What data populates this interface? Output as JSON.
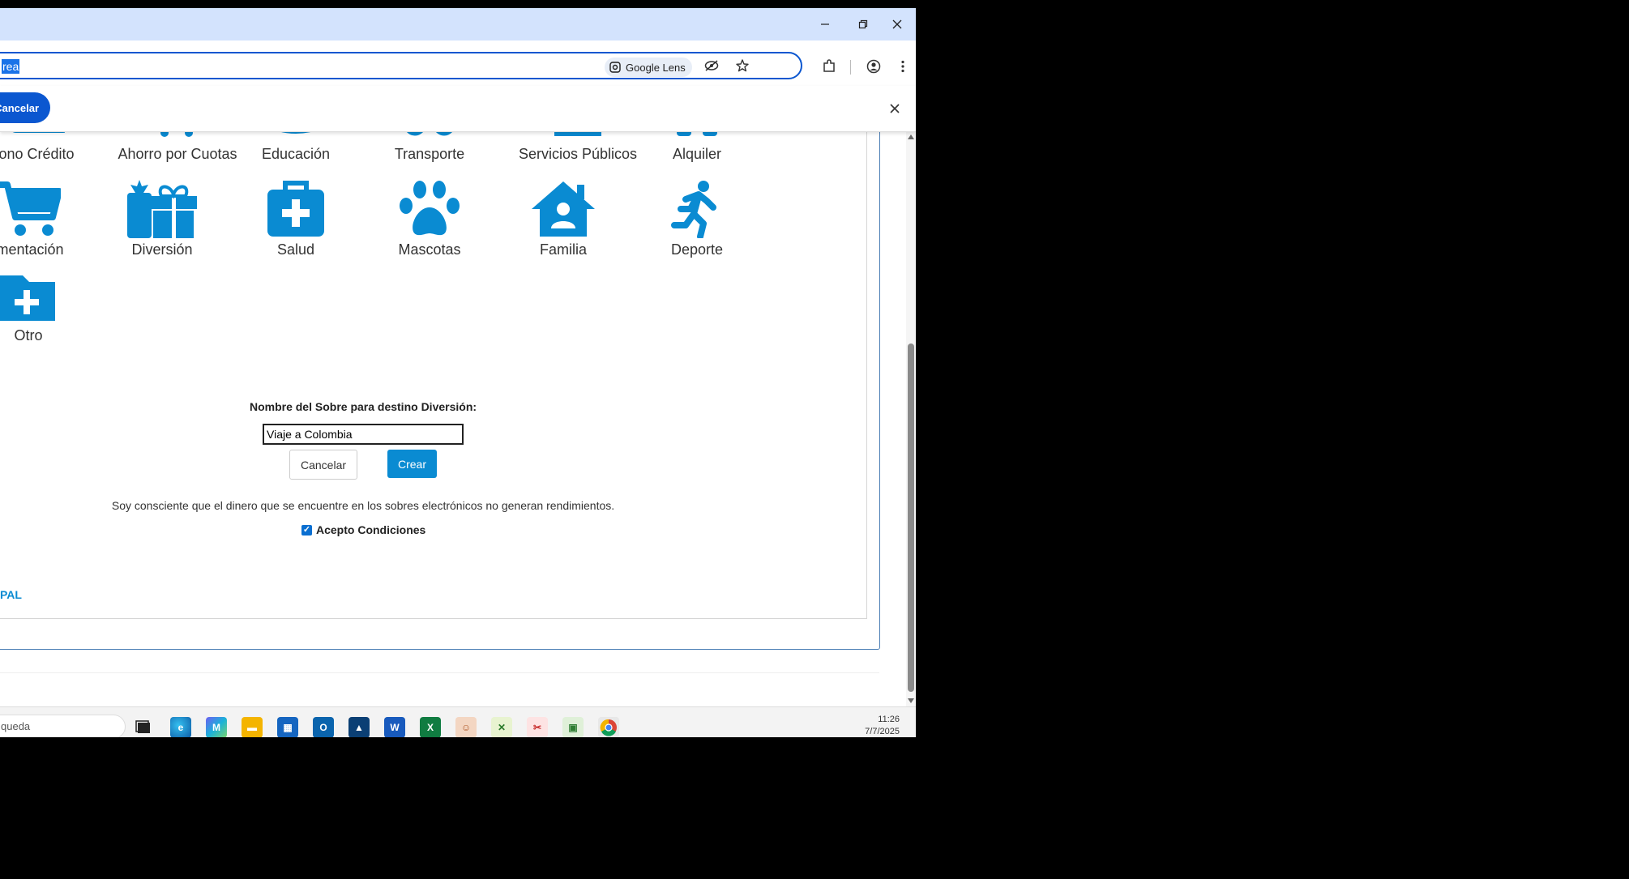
{
  "browser": {
    "address_text": "rea",
    "lens_label": "Google Lens",
    "find_bar": {
      "cancel_label": "Cancelar"
    }
  },
  "categories_row1": [
    {
      "label": "ono Crédito",
      "icon": "credit-icon"
    },
    {
      "label": "Ahorro por Cuotas",
      "icon": "cart-icon"
    },
    {
      "label": "Educación",
      "icon": "education-icon"
    },
    {
      "label": "Transporte",
      "icon": "transport-icon"
    },
    {
      "label": "Servicios Públicos",
      "icon": "building-icon"
    },
    {
      "label": "Alquiler",
      "icon": "rent-icon"
    }
  ],
  "categories_row2": [
    {
      "label": "imentación",
      "icon": "shopping-cart-icon"
    },
    {
      "label": "Diversión",
      "icon": "gift-icon"
    },
    {
      "label": "Salud",
      "icon": "medkit-icon"
    },
    {
      "label": "Mascotas",
      "icon": "paw-icon"
    },
    {
      "label": "Familia",
      "icon": "home-user-icon"
    },
    {
      "label": "Deporte",
      "icon": "running-icon"
    }
  ],
  "categories_row3": [
    {
      "label": "Otro",
      "icon": "folder-plus-icon"
    }
  ],
  "form": {
    "name_label": "Nombre del Sobre para destino Diversión:",
    "name_value": "Viaje a Colombia",
    "cancel_label": "Cancelar",
    "create_label": "Crear",
    "terms_text": "Soy consciente que el dinero que se encuentre en los sobres electrónicos no generan rendimientos.",
    "accept_label": "Acepto Condiciones",
    "accept_checked": true
  },
  "footer_link": "PAL",
  "taskbar": {
    "search_text": "queda",
    "time": "11:26",
    "date": "7/7/2025"
  },
  "colors": {
    "accent": "#0a8bd2",
    "chrome_blue": "#0b57d0",
    "titlebar": "#d3e3fd"
  }
}
